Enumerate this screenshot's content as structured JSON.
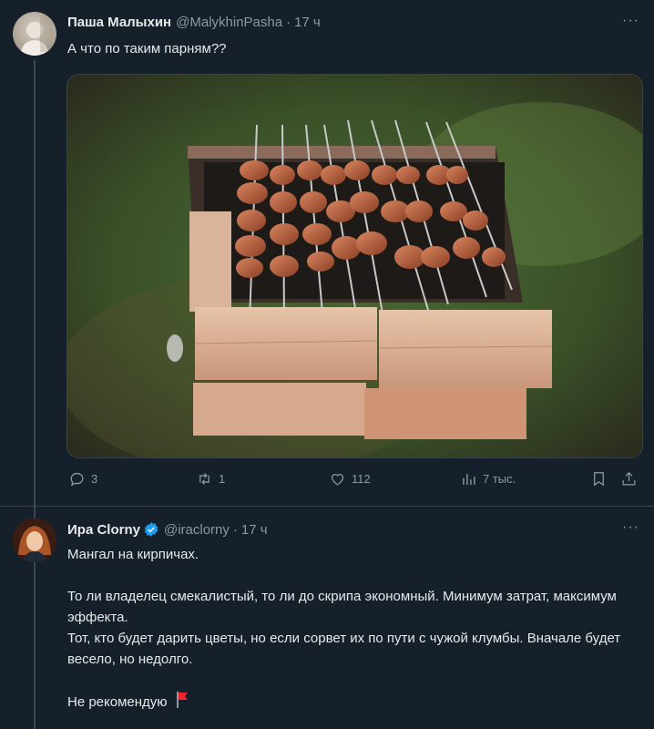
{
  "post1": {
    "author_name": "Паша Малыхин",
    "handle": "@MalykhinPasha",
    "separator": "·",
    "time": "17 ч",
    "more": "···",
    "text": "А что по таким парням??",
    "actions": {
      "replies": "3",
      "reposts": "1",
      "likes": "112",
      "views": "7 тыс."
    }
  },
  "post2": {
    "author_name": "Ира Clorny",
    "handle": "@iraclorny",
    "separator": "·",
    "time": "17 ч",
    "more": "···",
    "line1": "Мангал на кирпичах.",
    "line2": "То ли владелец смекалистый, то ли до скрипа экономный. Минимум затрат, максимум эффекта.",
    "line3": "Тот, кто будет дарить цветы, но если сорвет их по пути с чужой клумбы. Вначале будет весело, но недолго.",
    "line4": "Не рекомендую"
  },
  "colors": {
    "background": "#15202b",
    "text": "#e7e9ea",
    "muted": "#8b98a5",
    "verified": "#1d9bf0",
    "flag": "#f4212e"
  },
  "icons": [
    "reply-icon",
    "repost-icon",
    "like-icon",
    "views-icon",
    "bookmark-icon",
    "share-icon",
    "verified-badge-icon",
    "red-flag-icon",
    "more-icon"
  ]
}
